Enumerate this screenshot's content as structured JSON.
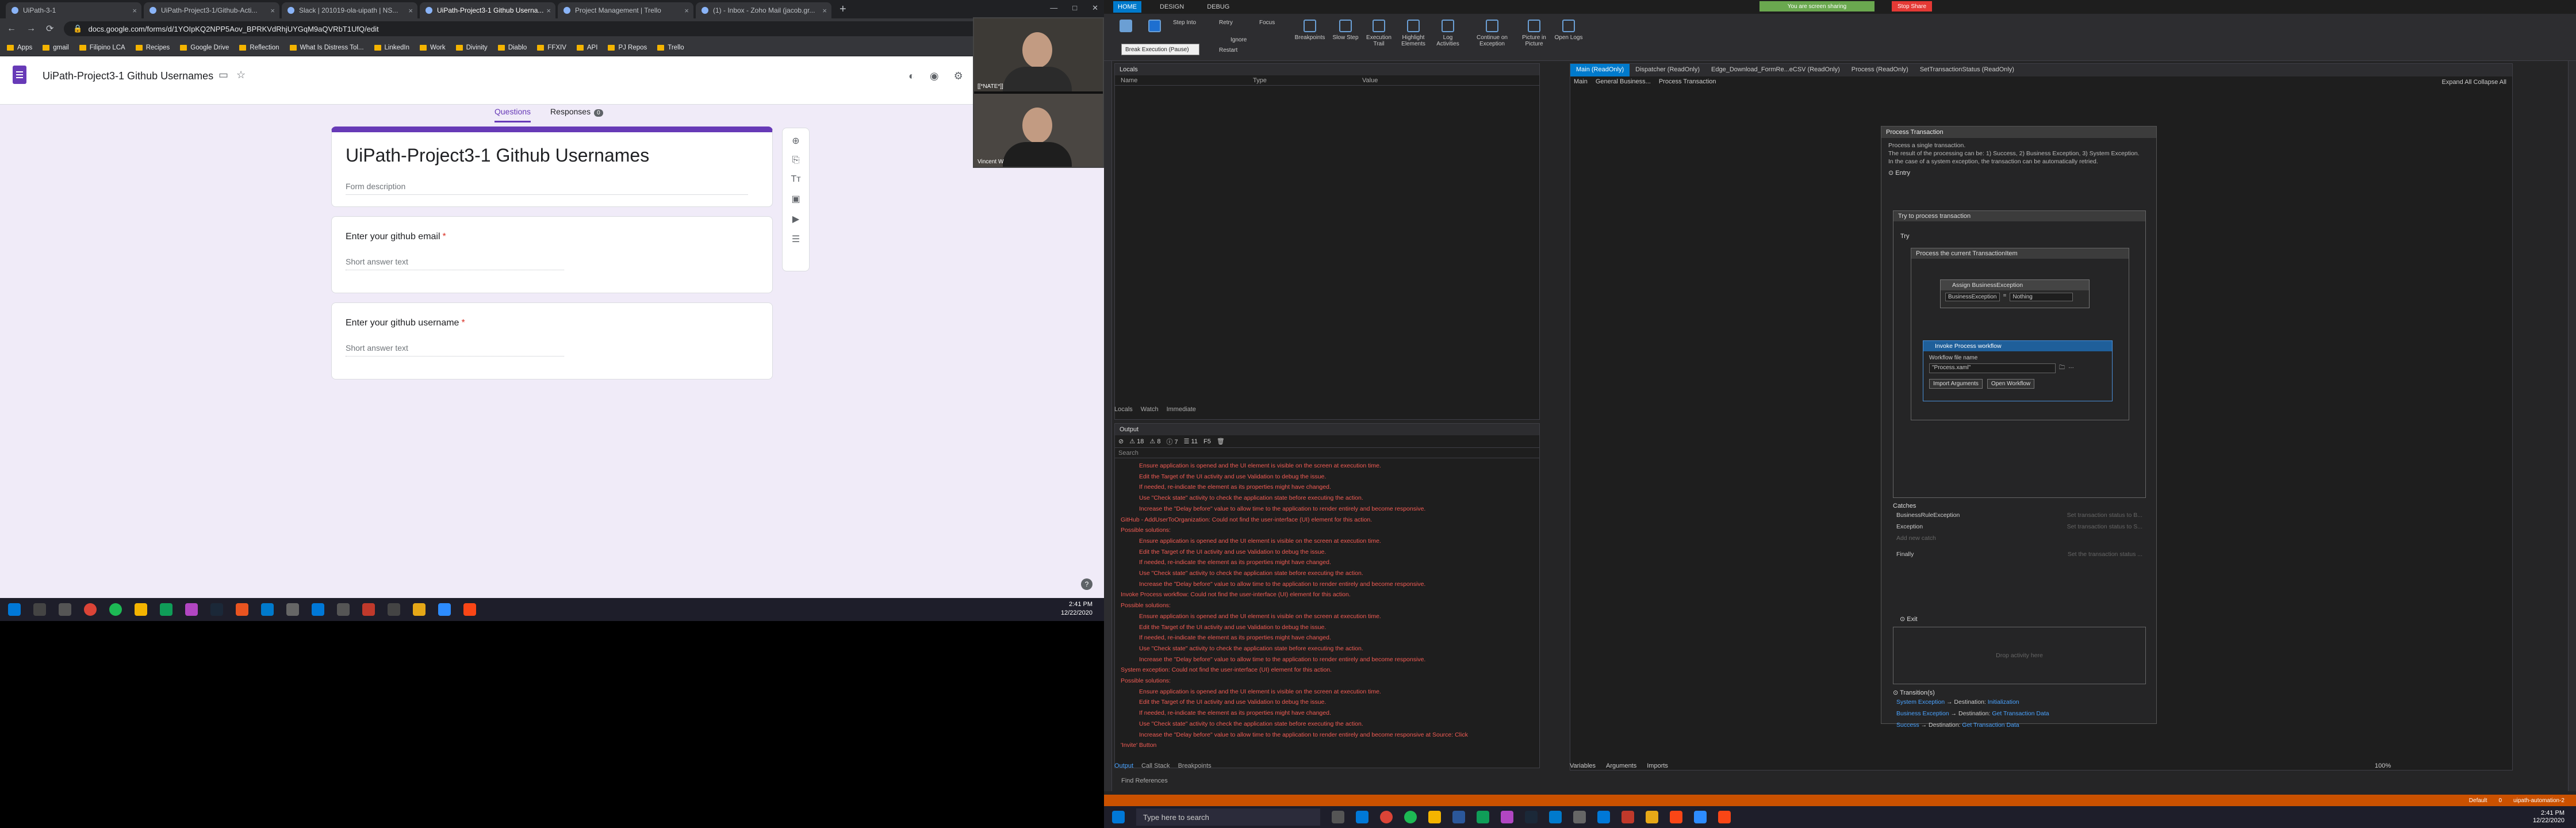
{
  "chrome": {
    "tabs": [
      {
        "title": "UiPath-3-1"
      },
      {
        "title": "UiPath-Project3-1/Github-Acti..."
      },
      {
        "title": "Slack | 201019-ola-uipath | NS..."
      },
      {
        "title": "UiPath-Project3-1 Github Userna..."
      },
      {
        "title": "Project Management | Trello"
      },
      {
        "title": "(1) - Inbox - Zoho Mail (jacob.gr..."
      }
    ],
    "url": "docs.google.com/forms/d/1YOIpKQ2NPP5Aov_BPRKVdRhjUYGqM9aQVRbT1UfQ/edit",
    "bookmarks": [
      "Apps",
      "gmail",
      "Filipino LCA",
      "Recipes",
      "Google Drive",
      "Reflection",
      "What Is Distress Tol...",
      "LinkedIn",
      "Work",
      "Divinity",
      "Diablo",
      "FFXIV",
      "API",
      "PJ Repos",
      "Trello"
    ]
  },
  "form": {
    "doc_title": "UiPath-Project3-1 Github Usernames",
    "tabs": {
      "questions": "Questions",
      "responses": "Responses",
      "responses_count": "0"
    },
    "title": "UiPath-Project3-1 Github Usernames",
    "description_placeholder": "Form description",
    "questions": [
      {
        "label": "Enter your github email",
        "required": "*",
        "placeholder": "Short answer text"
      },
      {
        "label": "Enter your github username",
        "required": "*",
        "placeholder": "Short answer text"
      }
    ],
    "help": "?"
  },
  "webcam": {
    "top_label": "[[*NATE*]]",
    "bottom_label": "Vincent W"
  },
  "taskbar_left": {
    "time": "2:41 PM",
    "date": "12/22/2020"
  },
  "studio": {
    "ribbon_tabs": [
      "HOME",
      "DESIGN",
      "DEBUG"
    ],
    "sharing": "You are screen sharing",
    "stop_share": "Stop Share",
    "ribbon_buttons": [
      "Step Into",
      "Retry",
      "Focus",
      "Ignore",
      "Restart",
      "Breakpoints",
      "Slow Step",
      "Execution Trail",
      "Highlight Elements",
      "Log Activities",
      "Continue on Exception",
      "Picture in Picture",
      "Open Logs"
    ],
    "tooltip": "Break Execution (Pause)",
    "locals": {
      "title": "Locals",
      "cols": [
        "Name",
        "Type",
        "Value"
      ],
      "tabs": [
        "Locals",
        "Watch",
        "Immediate"
      ]
    },
    "output": {
      "title": "Output",
      "filters": [
        "18",
        "8",
        "7",
        "11",
        "F5"
      ],
      "search": "Search",
      "lines": [
        {
          "t": "ind",
          "text": "Ensure application is opened and the UI element is visible on the screen at execution time."
        },
        {
          "t": "ind",
          "text": "Edit the Target of the UI activity and use Validation to debug the issue."
        },
        {
          "t": "ind",
          "text": "If needed, re-indicate the element as its properties might have changed."
        },
        {
          "t": "ind",
          "text": "Use \"Check state\" activity to check the application state before executing the action."
        },
        {
          "t": "ind",
          "text": "Increase the \"Delay before\" value to allow time to the application to render entirely and become responsive."
        },
        {
          "t": "hdr",
          "text": "GitHub - AddUserToOrganization: Could not find the user-interface (UI) element for this action."
        },
        {
          "t": "hdr",
          "text": "Possible solutions:"
        },
        {
          "t": "ind",
          "text": "Ensure application is opened and the UI element is visible on the screen at execution time."
        },
        {
          "t": "ind",
          "text": "Edit the Target of the UI activity and use Validation to debug the issue."
        },
        {
          "t": "ind",
          "text": "If needed, re-indicate the element as its properties might have changed."
        },
        {
          "t": "ind",
          "text": "Use \"Check state\" activity to check the application state before executing the action."
        },
        {
          "t": "ind",
          "text": "Increase the \"Delay before\" value to allow time to the application to render entirely and become responsive."
        },
        {
          "t": "hdr",
          "text": "Invoke Process workflow: Could not find the user-interface (UI) element for this action."
        },
        {
          "t": "hdr",
          "text": "Possible solutions:"
        },
        {
          "t": "ind",
          "text": "Ensure application is opened and the UI element is visible on the screen at execution time."
        },
        {
          "t": "ind",
          "text": "Edit the Target of the UI activity and use Validation to debug the issue."
        },
        {
          "t": "ind",
          "text": "If needed, re-indicate the element as its properties might have changed."
        },
        {
          "t": "ind",
          "text": "Use \"Check state\" activity to check the application state before executing the action."
        },
        {
          "t": "ind",
          "text": "Increase the \"Delay before\" value to allow time to the application to render entirely and become responsive."
        },
        {
          "t": "hdr",
          "text": "System exception: Could not find the user-interface (UI) element for this action."
        },
        {
          "t": "hdr",
          "text": "Possible solutions:"
        },
        {
          "t": "ind",
          "text": "Ensure application is opened and the UI element is visible on the screen at execution time."
        },
        {
          "t": "ind",
          "text": "Edit the Target of the UI activity and use Validation to debug the issue."
        },
        {
          "t": "ind",
          "text": "If needed, re-indicate the element as its properties might have changed."
        },
        {
          "t": "ind",
          "text": "Use \"Check state\" activity to check the application state before executing the action."
        },
        {
          "t": "ind",
          "text": "Increase the \"Delay before\" value to allow time to the application to render entirely and become responsive at Source: Click"
        },
        {
          "t": "hdr",
          "text": "'Invite' Button"
        }
      ],
      "tabs": [
        "Output",
        "Call Stack",
        "Breakpoints"
      ]
    },
    "find_refs": "Find References",
    "doc_tabs": [
      "Main (ReadOnly)",
      "Dispatcher (ReadOnly)",
      "Edge_Download_FormRe...eCSV (ReadOnly)",
      "Process (ReadOnly)",
      "SetTransactionStatus (ReadOnly)"
    ],
    "crumbs": [
      "Main",
      "General Business...",
      "Process Transaction"
    ],
    "expand": "Expand All  Collapse All",
    "state": {
      "title": "Process Transaction",
      "desc1": "Process a single transaction.",
      "desc2": "The result of the processing can be: 1) Success, 2) Business Exception, 3) System Exception.",
      "desc3": "In the case of a system exception, the transaction can be automatically retried.",
      "entry": "Entry",
      "try_title": "Try to process transaction",
      "try": "Try",
      "seq_title": "Process the current TransactionItem",
      "assign_title": "Assign BusinessException",
      "assign_to": "BusinessException",
      "assign_val": "Nothing",
      "invoke_title": "Invoke Process workflow",
      "wf_label": "Workflow file name",
      "wf_value": "\"Process.xaml\"",
      "import_btn": "Import Arguments",
      "open_btn": "Open Workflow",
      "catches": "Catches",
      "catch_rows": [
        {
          "name": "BusinessRuleException",
          "hint": "Set transaction status to B..."
        },
        {
          "name": "Exception",
          "hint": "Set transaction status to S..."
        }
      ],
      "add_catch": "Add new catch",
      "finally": "Finally",
      "finally_hint": "Set the transaction status ...",
      "exit": "Exit",
      "drop": "Drop activity here",
      "transitions": "Transition(s)",
      "trans_rows": [
        {
          "from": "System Exception",
          "to": "Initialization"
        },
        {
          "from": "Business Exception",
          "to": "Get Transaction Data"
        },
        {
          "from": "Success",
          "to": "Get Transaction Data"
        }
      ],
      "dest": "Destination:"
    },
    "bottom_tabs": [
      "Variables",
      "Arguments",
      "Imports"
    ],
    "zoom": "100%",
    "status": [
      "Default",
      "0",
      "uipath-automation-2"
    ],
    "search": "Type here to search",
    "time": "2:41 PM",
    "date": "12/22/2020"
  }
}
